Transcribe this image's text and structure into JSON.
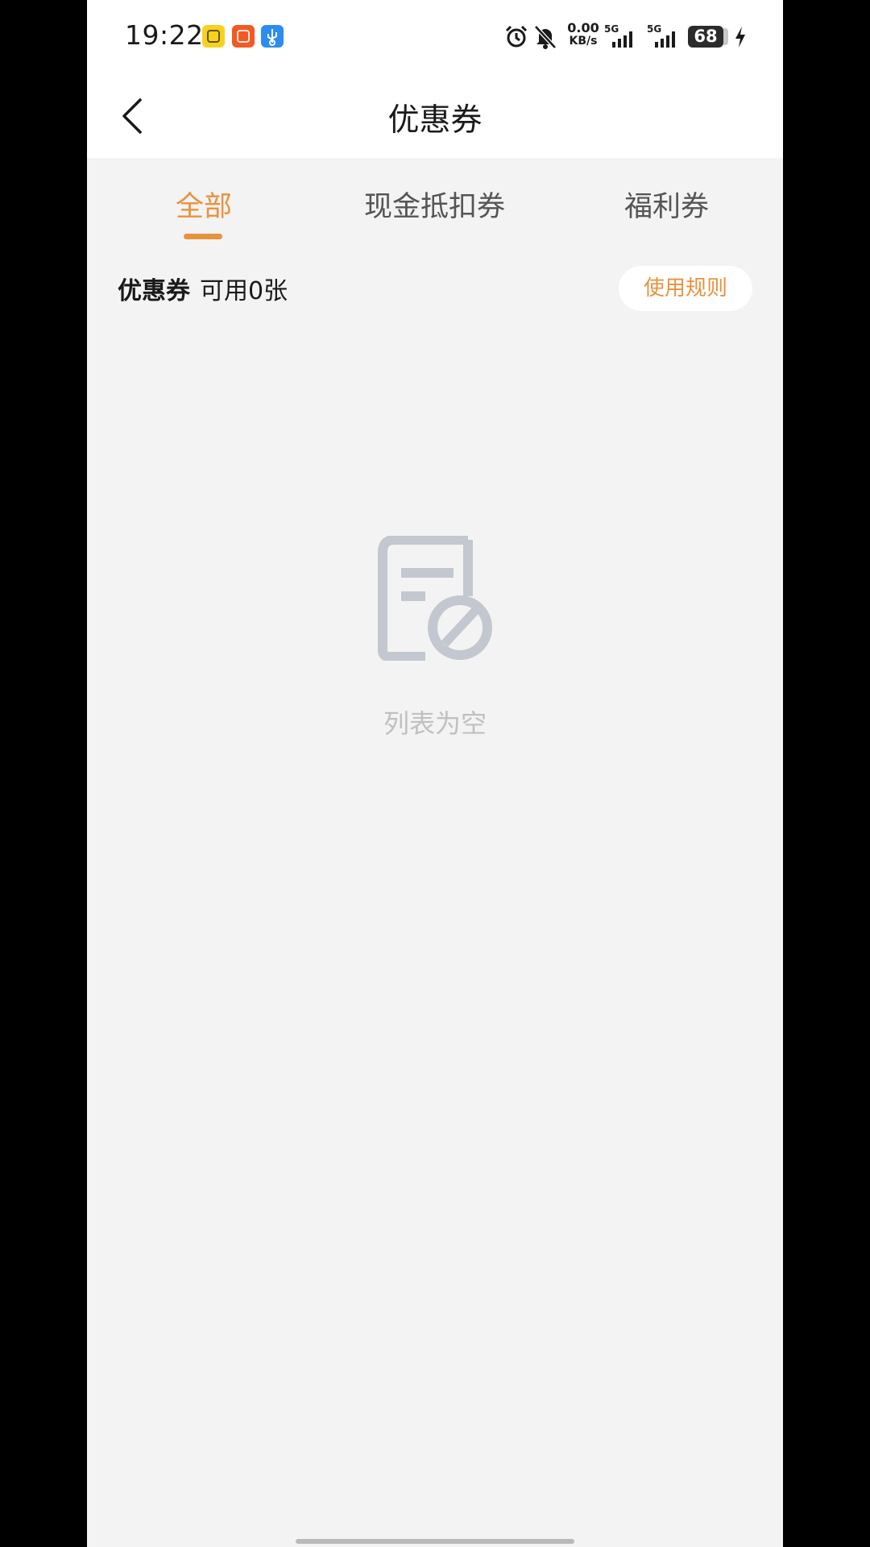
{
  "status_bar": {
    "time": "19:22",
    "net_speed_value": "0.00",
    "net_speed_unit": "KB/s",
    "signal1_label": "5G",
    "signal2_label": "5G",
    "battery": "68",
    "icons": [
      "alarm-icon",
      "mute-bell-icon",
      "signal-icon",
      "signal-icon",
      "battery-icon",
      "charging-bolt-icon"
    ],
    "app_badges": [
      "yellow-app-icon",
      "orange-app-icon",
      "usb-icon"
    ]
  },
  "header": {
    "back_icon": "chevron-left-icon",
    "title": "优惠券"
  },
  "tabs": [
    {
      "label": "全部",
      "active": true
    },
    {
      "label": "现金抵扣券",
      "active": false
    },
    {
      "label": "福利券",
      "active": false
    }
  ],
  "summary": {
    "label": "优惠券",
    "available_text": "可用0张"
  },
  "rules_button": {
    "label": "使用规则"
  },
  "empty_state": {
    "icon": "empty-list-icon",
    "text": "列表为空"
  },
  "colors": {
    "accent": "#e8923d",
    "background": "#f3f3f3",
    "empty_gray": "#c0c4cc"
  }
}
